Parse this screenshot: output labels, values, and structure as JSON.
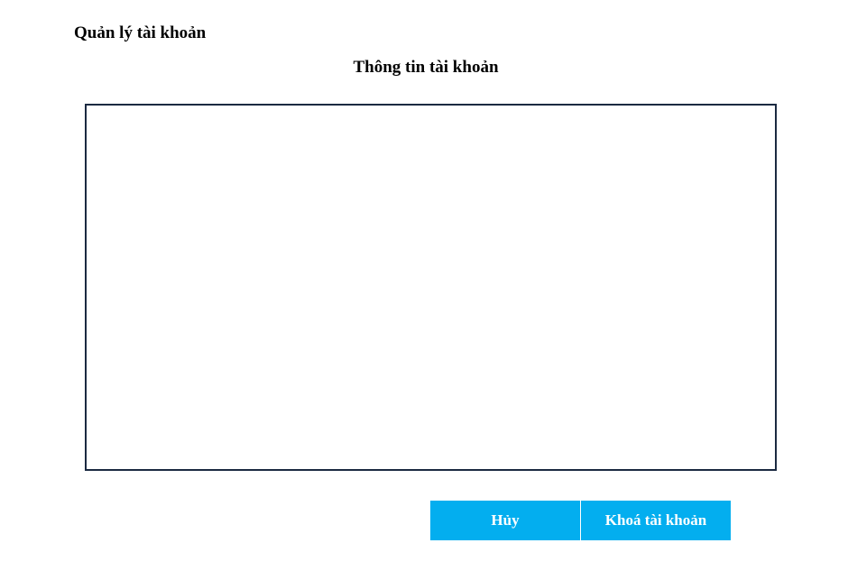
{
  "header": {
    "title": "Quản lý tài khoản"
  },
  "main": {
    "section_title": "Thông tin tài khoản"
  },
  "actions": {
    "cancel_label": "Hủy",
    "lock_label": "Khoá tài khoản"
  },
  "colors": {
    "button_background": "#03aeef",
    "button_text": "#ffffff",
    "panel_border": "#1b2a41"
  }
}
